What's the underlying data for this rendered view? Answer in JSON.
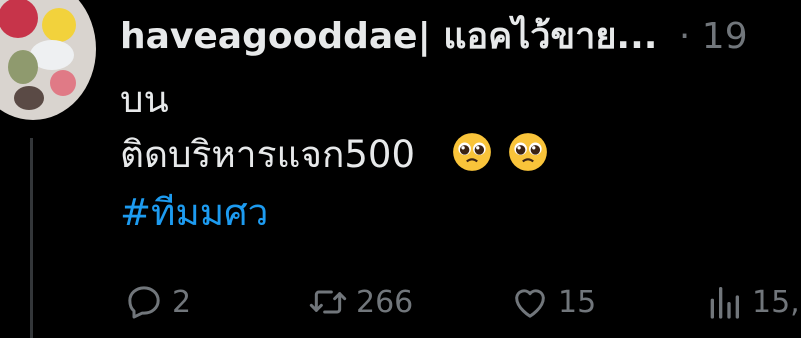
{
  "tweet": {
    "author_name": "haveagooddae| แอคไว้ขาย...",
    "separator": "·",
    "timestamp": "19",
    "text_line1": "บน",
    "text_line2": "ติดบริหารแจก500",
    "emoji": "pleading-face-emoji",
    "hashtag": "#ทีมมศว"
  },
  "actions": {
    "replies": "2",
    "retweets": "266",
    "likes": "15",
    "views": "15,"
  },
  "colors": {
    "background": "#000000",
    "text": "#e7e9ea",
    "muted": "#71767b",
    "link": "#1d9bf0",
    "thread_line": "#333639"
  }
}
